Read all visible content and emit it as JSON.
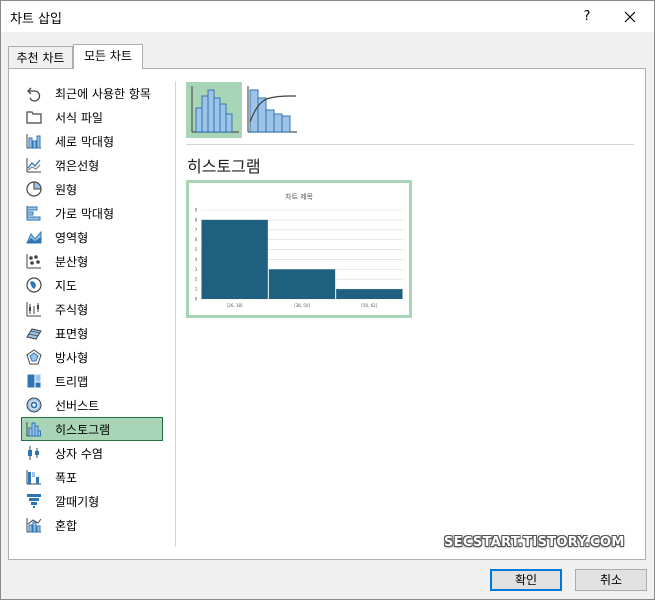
{
  "window": {
    "title": "차트 삽입",
    "help": "?",
    "close_icon": "close-icon"
  },
  "tabs": [
    {
      "label": "추천 차트",
      "active": false
    },
    {
      "label": "모든 차트",
      "active": true
    }
  ],
  "sidebar": {
    "items": [
      {
        "label": "최근에 사용한 항목",
        "icon": "recent-icon"
      },
      {
        "label": "서식 파일",
        "icon": "folder-icon"
      },
      {
        "label": "세로 막대형",
        "icon": "column-chart-icon"
      },
      {
        "label": "꺾은선형",
        "icon": "line-chart-icon"
      },
      {
        "label": "원형",
        "icon": "pie-chart-icon"
      },
      {
        "label": "가로 막대형",
        "icon": "bar-chart-icon"
      },
      {
        "label": "영역형",
        "icon": "area-chart-icon"
      },
      {
        "label": "분산형",
        "icon": "scatter-chart-icon"
      },
      {
        "label": "지도",
        "icon": "map-chart-icon"
      },
      {
        "label": "주식형",
        "icon": "stock-chart-icon"
      },
      {
        "label": "표면형",
        "icon": "surface-chart-icon"
      },
      {
        "label": "방사형",
        "icon": "radar-chart-icon"
      },
      {
        "label": "트리맵",
        "icon": "treemap-chart-icon"
      },
      {
        "label": "선버스트",
        "icon": "sunburst-chart-icon"
      },
      {
        "label": "히스토그램",
        "icon": "histogram-chart-icon",
        "selected": true
      },
      {
        "label": "상자 수염",
        "icon": "box-whisker-chart-icon"
      },
      {
        "label": "폭포",
        "icon": "waterfall-chart-icon"
      },
      {
        "label": "깔때기형",
        "icon": "funnel-chart-icon"
      },
      {
        "label": "혼합",
        "icon": "combo-chart-icon"
      }
    ]
  },
  "main": {
    "subtypes": [
      {
        "name": "histogram",
        "icon": "histogram-subtype-icon",
        "selected": true
      },
      {
        "name": "pareto",
        "icon": "pareto-subtype-icon",
        "selected": false
      }
    ],
    "heading": "히스토그램"
  },
  "chart_data": {
    "type": "bar",
    "title": "차트 제목",
    "categories": [
      "[26, 38]",
      "[38, 50]",
      "[50, 62]"
    ],
    "values": [
      8,
      3,
      1
    ],
    "ylim": [
      0,
      9
    ],
    "yticks": [
      "0",
      "1",
      "2",
      "3",
      "4",
      "5",
      "6",
      "7",
      "8",
      "9"
    ],
    "grid": true,
    "bar_color": "#1f5f7f"
  },
  "buttons": {
    "ok": "확인",
    "cancel": "취소"
  },
  "watermark": "SECSTART.TISTORY.COM",
  "colors": {
    "selection_fill": "#a8d5b5",
    "selection_border": "#217346",
    "icon_blue": "#2e75b6",
    "icon_light_blue": "#9dc3e6",
    "bar": "#1f5f7f"
  }
}
